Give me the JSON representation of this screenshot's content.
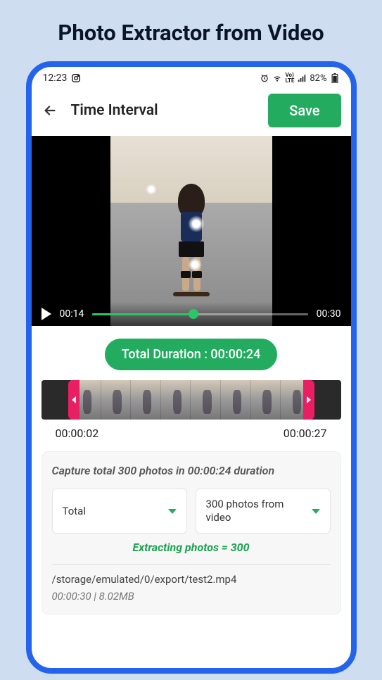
{
  "page_title": "Photo Extractor from Video",
  "status": {
    "time": "12:23",
    "battery": "82%"
  },
  "appbar": {
    "title": "Time Interval",
    "save_label": "Save"
  },
  "player": {
    "current_time": "00:14",
    "total_time": "00:30"
  },
  "duration_pill": "Total Duration : 00:00:24",
  "trim": {
    "start": "00:00:02",
    "end": "00:00:27"
  },
  "capture": {
    "summary": "Capture total 300 photos in 00:00:24 duration",
    "mode_label": "Total",
    "count_label": "300 photos from video",
    "extracting": "Extracting photos = 300"
  },
  "file": {
    "path": "/storage/emulated/0/export/test2.mp4",
    "meta": "00:00:30  |  8.02MB"
  }
}
